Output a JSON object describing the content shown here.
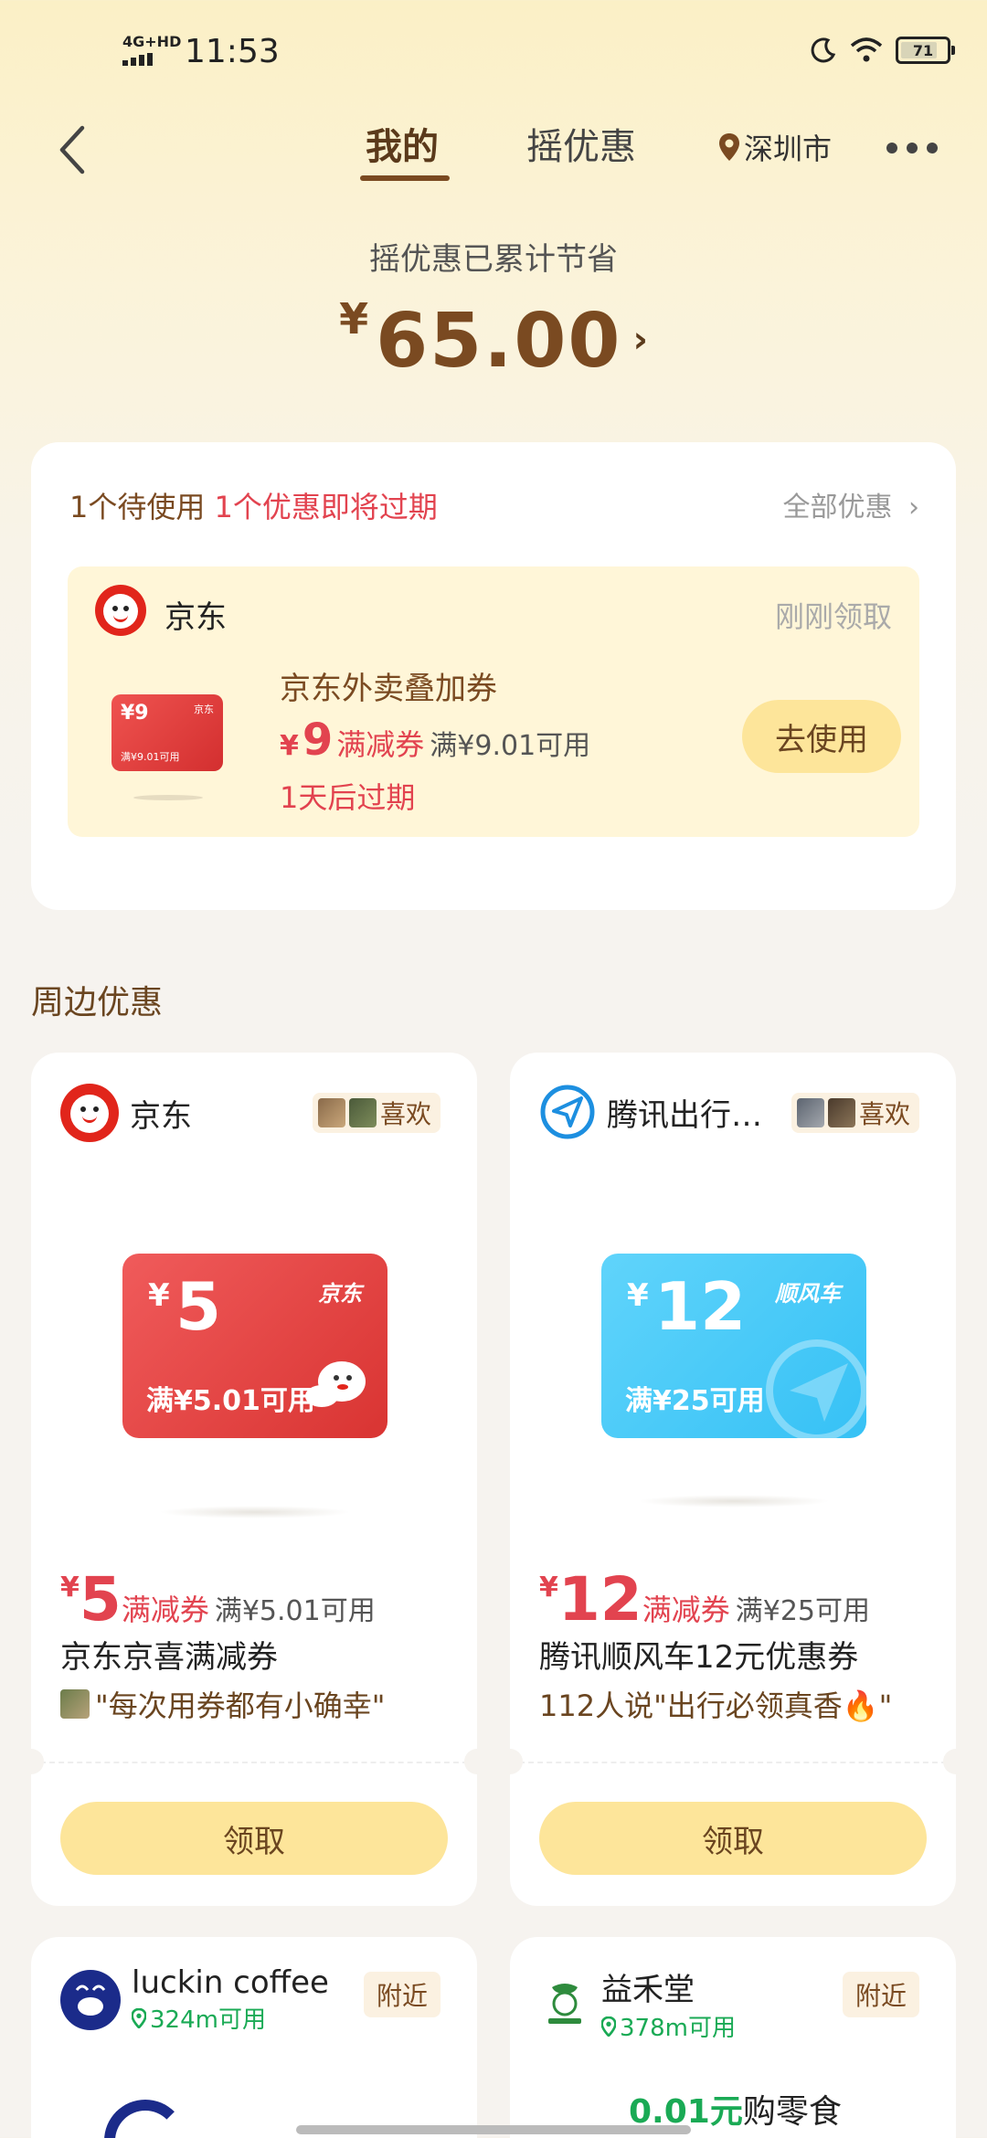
{
  "status_bar": {
    "network": "4G+HD",
    "time": "11:53",
    "battery": "71"
  },
  "nav": {
    "tabs": [
      {
        "label": "我的",
        "active": true
      },
      {
        "label": "摇优惠",
        "active": false
      }
    ],
    "city": "深圳市"
  },
  "savings": {
    "label": "摇优惠已累计节省",
    "currency": "¥",
    "amount": "65.00"
  },
  "mine": {
    "pending": "1个待使用",
    "expiring": "1个优惠即将过期",
    "all_link": "全部优惠",
    "coupon": {
      "brand": "京东",
      "time": "刚刚领取",
      "mini_value": "¥9",
      "mini_brand": "京东",
      "mini_condition": "满¥9.01可用",
      "title": "京东外卖叠加券",
      "currency": "¥",
      "value": "9",
      "type": "满减券",
      "condition": "满¥9.01可用",
      "expire": "1天后过期",
      "button": "去使用"
    }
  },
  "nearby": {
    "title": "周边优惠",
    "cards": [
      {
        "brand": "京东",
        "like": "喜欢",
        "coupon_currency": "¥",
        "coupon_value": "5",
        "coupon_brand": "京东",
        "coupon_condition": "满¥5.01可用",
        "price_currency": "¥",
        "price_value": "5",
        "price_type": "满减券",
        "price_condition": "满¥5.01可用",
        "title": "京东京喜满减券",
        "quote": "\"每次用券都有小确幸\"",
        "button": "领取"
      },
      {
        "brand": "腾讯出行…",
        "like": "喜欢",
        "coupon_currency": "¥",
        "coupon_value": "12",
        "coupon_brand": "顺风车",
        "coupon_condition": "满¥25可用",
        "price_currency": "¥",
        "price_value": "12",
        "price_type": "满减券",
        "price_condition": "满¥25可用",
        "title": "腾讯顺风车12元优惠券",
        "quote": "112人说\"出行必领真香🔥\"",
        "button": "领取"
      },
      {
        "brand": "luckin coffee",
        "distance": "324m可用",
        "badge": "附近"
      },
      {
        "brand": "益禾堂",
        "distance": "378m可用",
        "badge": "附近",
        "promo_value": "0.01元",
        "promo_text": "购零食"
      }
    ]
  },
  "colors": {
    "accent_brown": "#7a4a21",
    "red": "#e2434f",
    "button_yellow": "#fde59a",
    "green": "#1aaa55",
    "jd_red": "#e1251b",
    "blue_coupon": "#36c1f5"
  }
}
